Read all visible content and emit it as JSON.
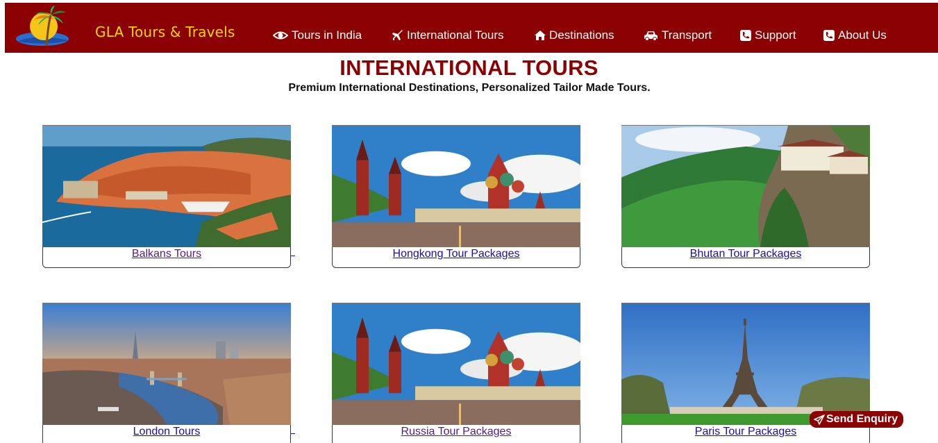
{
  "brand": {
    "name": "GLA Tours & Travels"
  },
  "nav": {
    "tours_india": "Tours in India",
    "international": "International Tours",
    "destinations": "Destinations",
    "transport": "Transport",
    "support": "Support",
    "about": "About Us"
  },
  "header": {
    "title": "INTERNATIONAL TOURS",
    "subtitle": "Premium International Destinations, Personalized Tailor Made Tours."
  },
  "tours": [
    {
      "label": "Balkans Tours",
      "visited": true
    },
    {
      "label": "Hongkong Tour Packages",
      "visited": false
    },
    {
      "label": "Bhutan Tour Packages",
      "visited": false
    },
    {
      "label": "London Tours",
      "visited": false
    },
    {
      "label": "Russia Tour Packages",
      "visited": true
    },
    {
      "label": "Paris Tour Packages",
      "visited": false
    }
  ],
  "enquiry": {
    "label": "Send Enquiry"
  },
  "colors": {
    "brand_red": "#8b0000",
    "brand_yellow": "#ffd700",
    "link": "#1a0dab",
    "visited_link": "#551a8b"
  }
}
